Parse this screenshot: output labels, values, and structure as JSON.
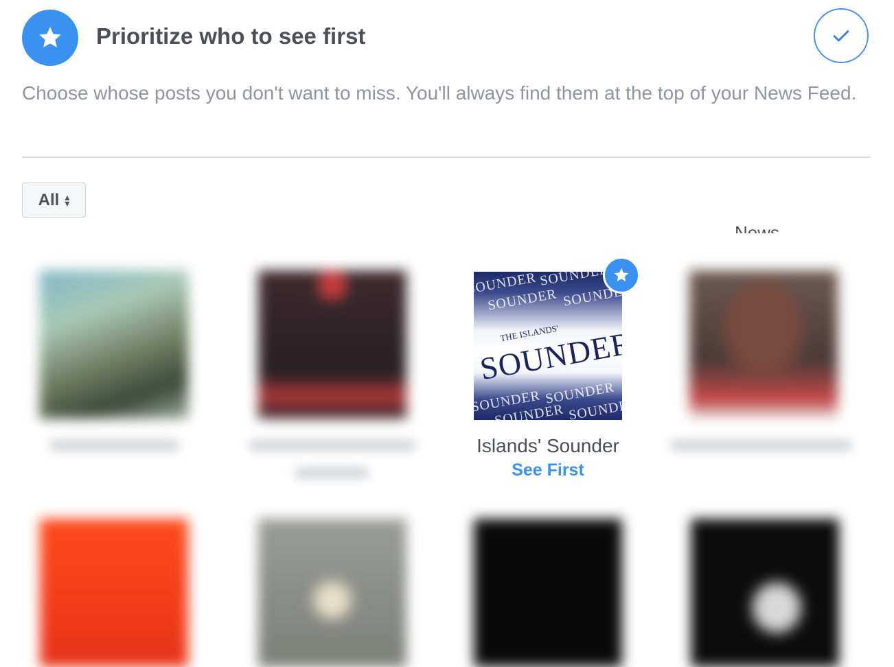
{
  "header": {
    "title": "Prioritize who to see first",
    "description": "Choose whose posts you don't want to miss. You'll always find them at the top of your News Feed.",
    "icon": "star-icon",
    "done_icon": "checkmark-icon",
    "accent_color": "#3b91ef"
  },
  "filter": {
    "selected": "All",
    "icon": "updown-arrows-icon"
  },
  "cutoff_label": "News",
  "pages": [
    {
      "name": "",
      "status": "",
      "blurred": true
    },
    {
      "name": "",
      "status": "",
      "blurred": true
    },
    {
      "name": "Islands' Sounder",
      "status": "See First",
      "blurred": false,
      "starred": true
    },
    {
      "name": "",
      "status": "",
      "blurred": true
    },
    {
      "name": "",
      "status": "",
      "blurred": true
    },
    {
      "name": "",
      "status": "",
      "blurred": true
    },
    {
      "name": "",
      "status": "",
      "blurred": true
    },
    {
      "name": "",
      "status": "",
      "blurred": true
    }
  ],
  "sounder_logo": {
    "small_caption": "THE ISLANDS'",
    "main_word": "SOUNDER",
    "repeat_word": "SOUNDER"
  }
}
